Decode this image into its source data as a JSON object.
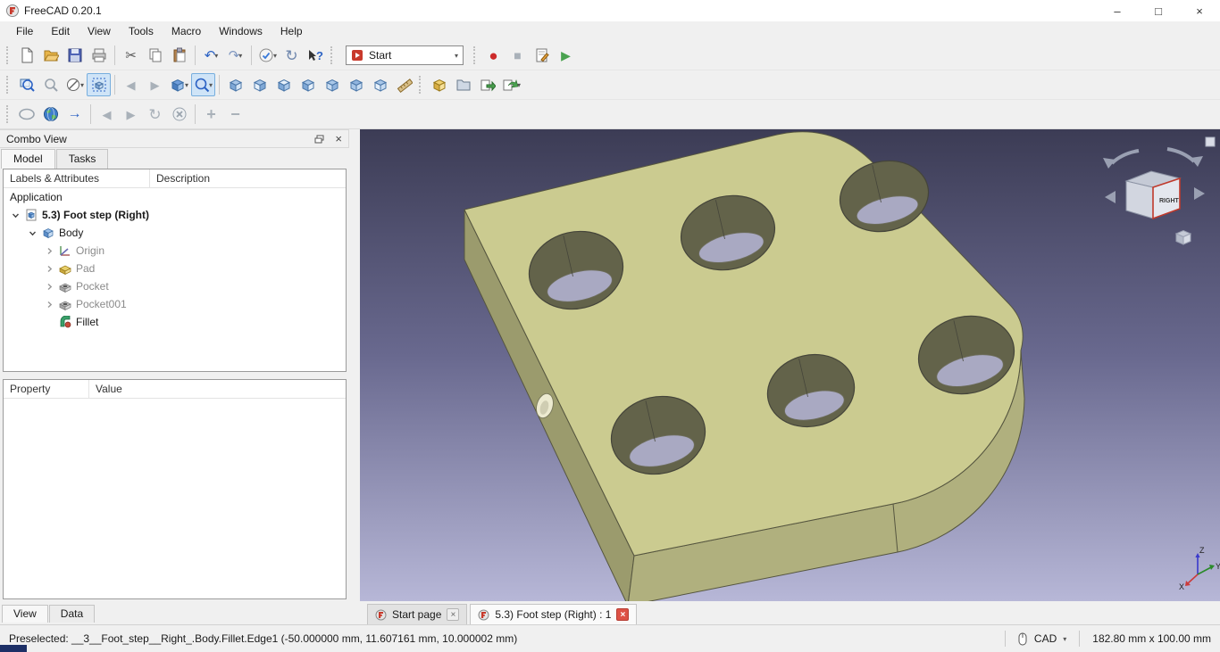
{
  "window": {
    "title": "FreeCAD 0.20.1"
  },
  "ui": {
    "caret": "▾",
    "close": "×",
    "minimize": "–",
    "maximize": "□"
  },
  "menubar": {
    "items": [
      "File",
      "Edit",
      "View",
      "Tools",
      "Macro",
      "Windows",
      "Help"
    ]
  },
  "toolbar": {
    "workbench": "Start",
    "glyphs": {
      "cut": "✂",
      "undo": "↶",
      "redo": "↷",
      "refresh": "↻",
      "whatsthis": "?",
      "record": "●",
      "stop": "■",
      "play": "▶",
      "back": "◀",
      "forward": "▶",
      "go": "→",
      "zoom_in": "+",
      "zoom_out": "−"
    }
  },
  "combo_view": {
    "title": "Combo View",
    "tabs": {
      "model": "Model",
      "tasks": "Tasks"
    },
    "tree_headers": {
      "labels": "Labels & Attributes",
      "description": "Description"
    },
    "tree": {
      "root": "Application",
      "document": "5.3) Foot step (Right)",
      "body": "Body",
      "children": [
        "Origin",
        "Pad",
        "Pocket",
        "Pocket001",
        "Fillet"
      ]
    },
    "property_table": {
      "property": "Property",
      "value": "Value"
    },
    "bottom_tabs": {
      "view": "View",
      "data": "Data"
    }
  },
  "viewport": {
    "nav_cube": {
      "front_label": "RIGHT"
    },
    "axes": {
      "x": "X",
      "y": "Y",
      "z": "Z"
    }
  },
  "document_tabs": [
    {
      "label": "Start page"
    },
    {
      "label": "5.3) Foot step (Right) : 1"
    }
  ],
  "statusbar": {
    "message": "Preselected: __3__Foot_step__Right_.Body.Fillet.Edge1 (-50.000000 mm, 11.607161 mm, 10.000002 mm)",
    "nav_style": "CAD",
    "dimensions": "182.80 mm x 100.00 mm"
  }
}
